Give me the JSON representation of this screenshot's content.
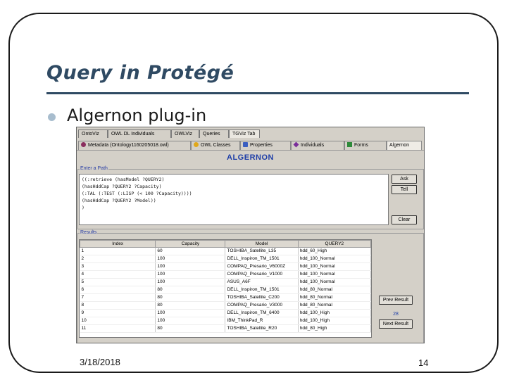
{
  "slide": {
    "title": "Query in Protégé",
    "bullet": "Algernon plug-in",
    "date": "3/18/2018",
    "page": "14"
  },
  "app": {
    "tabs_row1": [
      "OntoViz",
      "OWL DL Individuals",
      "OWLViz",
      "Queries",
      "TGViz Tab"
    ],
    "tabs_row1_selected": "TGViz Tab",
    "tabs_row2": [
      {
        "label": "Metadata (Ontology1160205018.owl)",
        "icon": "metadata-icon",
        "color": "#8a2e5e"
      },
      {
        "label": "OWL Classes",
        "icon": "owl-classes-icon",
        "color": "#e0a81a"
      },
      {
        "label": "Properties",
        "icon": "properties-icon",
        "color": "#3a5ec0"
      },
      {
        "label": "Individuals",
        "icon": "individuals-icon",
        "color": "#7a2e9a"
      },
      {
        "label": "Forms",
        "icon": "forms-icon",
        "color": "#2e8a3a"
      },
      {
        "label": "Algernon",
        "icon": "",
        "color": ""
      }
    ],
    "tabs_row2_selected": "Algernon",
    "heading": "ALGERNON",
    "query_legend": "Enter a Path",
    "query_lines": [
      "((:retrieve (hasModel ?QUERY2)",
      "(hasHddCap ?QUERY2 ?Capacity)",
      "(:TAL (:TEST (:LISP (< 100 ?Capacity))))",
      "(hasHddCap ?QUERY2 ?Model))",
      ")"
    ],
    "buttons": {
      "ask": "Ask",
      "tell": "Tell",
      "clear": "Clear",
      "prev": "Prev Result",
      "next": "Next Result"
    },
    "results_legend": "Results",
    "result_count": "28",
    "columns": [
      "Index",
      "Capacity",
      "Model",
      "QUERY2"
    ],
    "rows": [
      [
        "1",
        "60",
        "TOSHIBA_Satellite_L35",
        "hdd_60_High"
      ],
      [
        "2",
        "100",
        "DELL_Inspiron_TM_1501",
        "hdd_100_Normal"
      ],
      [
        "3",
        "100",
        "COMPAQ_Presario_V6000Z",
        "hdd_100_Normal"
      ],
      [
        "4",
        "100",
        "COMPAQ_Presario_V1000",
        "hdd_100_Normal"
      ],
      [
        "5",
        "100",
        "ASUS_A6F",
        "hdd_100_Normal"
      ],
      [
        "6",
        "80",
        "DELL_Inspiron_TM_1501",
        "hdd_80_Normal"
      ],
      [
        "7",
        "80",
        "TOSHIBA_Satellite_C200",
        "hdd_80_Normal"
      ],
      [
        "8",
        "80",
        "COMPAQ_Presario_V3000",
        "hdd_80_Normal"
      ],
      [
        "9",
        "100",
        "DELL_Inspiron_TM_6400",
        "hdd_100_High"
      ],
      [
        "10",
        "100",
        "IBM_ThinkPad_R",
        "hdd_100_High"
      ],
      [
        "11",
        "80",
        "TOSHIBA_Satellite_R20",
        "hdd_80_High"
      ]
    ]
  }
}
